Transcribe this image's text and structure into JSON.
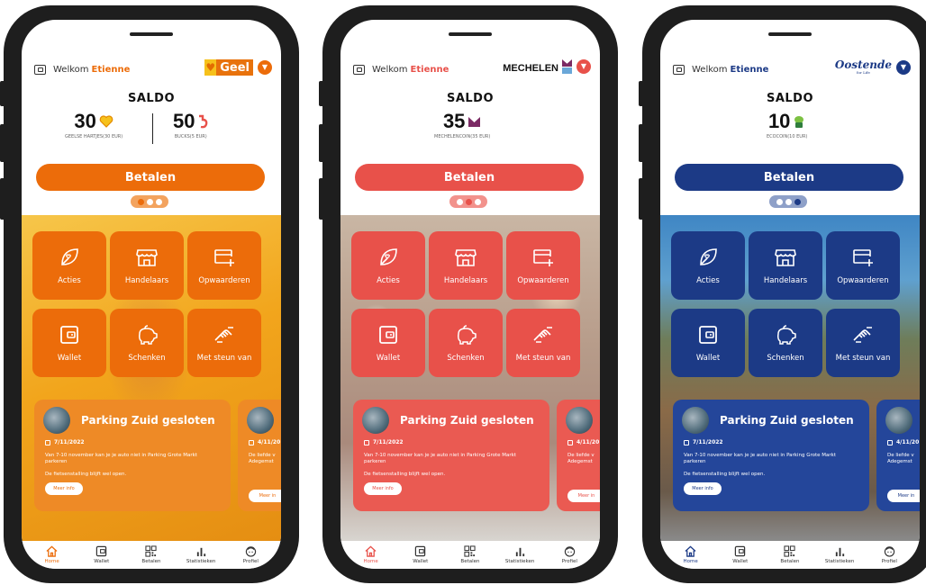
{
  "common": {
    "welcome_prefix": "Welkom",
    "user_name": "Etienne",
    "saldo_title": "SALDO",
    "pay_label": "Betalen",
    "tiles": [
      {
        "label": "Acties",
        "icon": "leaf-heart-icon"
      },
      {
        "label": "Handelaars",
        "icon": "store-icon"
      },
      {
        "label": "Opwaarderen",
        "icon": "card-plus-icon"
      },
      {
        "label": "Wallet",
        "icon": "wallet-icon"
      },
      {
        "label": "Schenken",
        "icon": "piggy-bank-icon"
      },
      {
        "label": "Met steun van",
        "icon": "handshake-icon"
      }
    ],
    "news": {
      "title": "Parking Zuid gesloten",
      "date": "7/11/2022",
      "body": "Van 7-10 november kan je je auto niet in Parking Grote Markt parkeren",
      "body2": "De fietsenstalling blijft wel open.",
      "more": "Meer info",
      "next_date": "4/11/20",
      "next_body": "De liefde v Adegemst",
      "next_more": "Meer in"
    },
    "tabs": [
      {
        "label": "Home",
        "icon": "home-icon"
      },
      {
        "label": "Wallet",
        "icon": "wallet-icon"
      },
      {
        "label": "Betalen",
        "icon": "qr-code-icon"
      },
      {
        "label": "Statistieken",
        "icon": "bar-chart-icon"
      },
      {
        "label": "Profiel",
        "icon": "profile-face-icon"
      }
    ]
  },
  "phones": [
    {
      "city_logo": "Geel",
      "accent": "#ec6c0a",
      "balances": [
        {
          "value": "30",
          "label": "GEELSE HARTJES(30 EUR)",
          "currency_icon": "heart-icon"
        },
        {
          "value": "50",
          "label": "BUCKS(5 EUR)",
          "currency_icon": "buck-icon"
        }
      ],
      "active_page": 0
    },
    {
      "city_logo": "MECHELEN",
      "accent": "#e8514a",
      "balances": [
        {
          "value": "35",
          "label": "MECHELENCOIN(35 EUR)",
          "currency_icon": "m-coin-icon"
        }
      ],
      "active_page": 1
    },
    {
      "city_logo": "Oostende",
      "city_logo_small": "for Life",
      "accent": "#1c3a86",
      "balances": [
        {
          "value": "10",
          "label": "ECOCOIN(10 EUR)",
          "currency_icon": "eco-coin-icon"
        }
      ],
      "active_page": 2
    }
  ]
}
